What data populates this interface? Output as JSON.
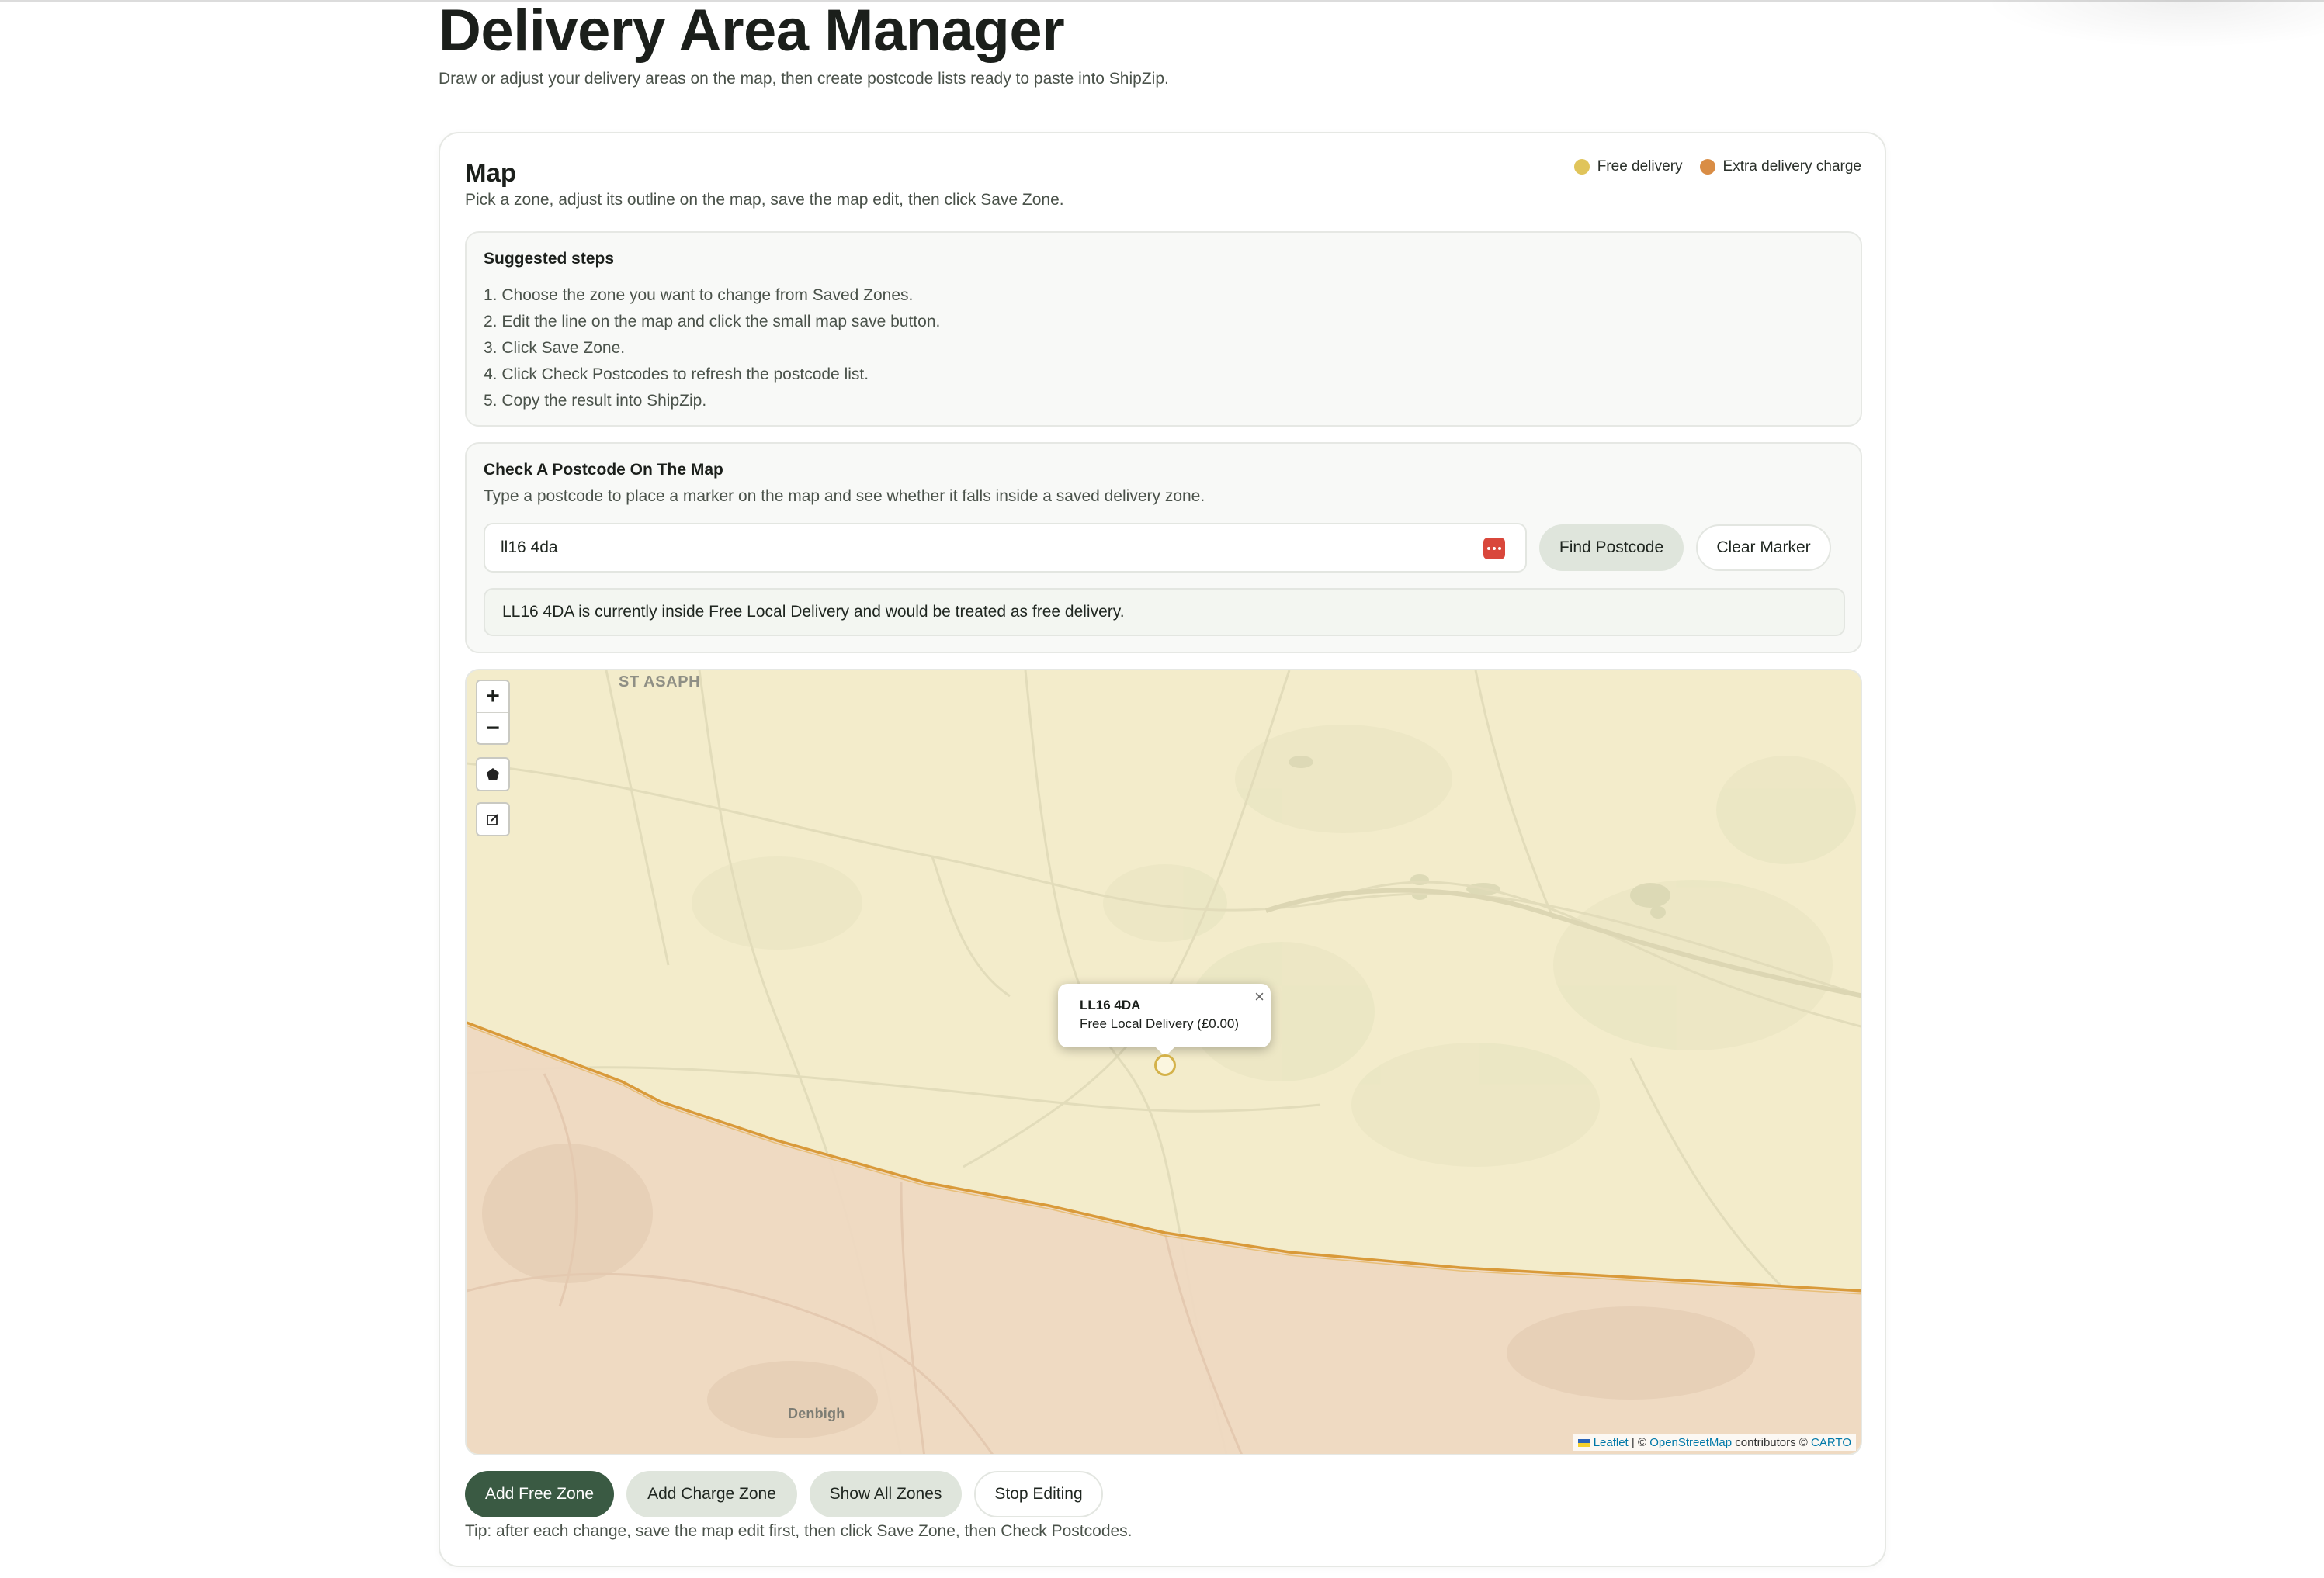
{
  "header": {
    "title": "Delivery Area Manager",
    "subtitle": "Draw or adjust your delivery areas on the map, then create postcode lists ready to paste into ShipZip."
  },
  "map_card": {
    "title": "Map",
    "subtitle": "Pick a zone, adjust its outline on the map, save the map edit, then click Save Zone.",
    "legend": [
      {
        "label": "Free delivery",
        "color": "#e0c45a"
      },
      {
        "label": "Extra delivery charge",
        "color": "#d98d45"
      }
    ]
  },
  "steps": {
    "title": "Suggested steps",
    "items": [
      "1. Choose the zone you want to change from Saved Zones.",
      "2. Edit the line on the map and click the small map save button.",
      "3. Click Save Zone.",
      "4. Click Check Postcodes to refresh the postcode list.",
      "5. Copy the result into ShipZip."
    ]
  },
  "check": {
    "title": "Check A Postcode On The Map",
    "subtitle": "Type a postcode to place a marker on the map and see whether it falls inside a saved delivery zone.",
    "input_value": "ll16 4da",
    "find_label": "Find Postcode",
    "clear_label": "Clear Marker",
    "result": "LL16 4DA is currently inside Free Local Delivery and would be treated as free delivery."
  },
  "map": {
    "zoom_in": "+",
    "zoom_out": "−",
    "places": {
      "st_asaph": "ST ASAPH",
      "denbigh": "Denbigh"
    },
    "popup": {
      "title": "LL16 4DA",
      "text": "Free Local Delivery (£0.00)",
      "close": "×"
    },
    "attribution": {
      "leaflet": "Leaflet",
      "sep1": " | © ",
      "osm": "OpenStreetMap",
      "sep2": " contributors © ",
      "carto": "CARTO"
    },
    "colors": {
      "free_zone": "#f3eccb",
      "charge_zone": "#efd8c1",
      "boundary": "#d99a3a"
    }
  },
  "actions": {
    "add_free": "Add Free Zone",
    "add_charge": "Add Charge Zone",
    "show_all": "Show All Zones",
    "stop_editing": "Stop Editing",
    "tip": "Tip: after each change, save the map edit first, then click Save Zone, then Check Postcodes."
  }
}
